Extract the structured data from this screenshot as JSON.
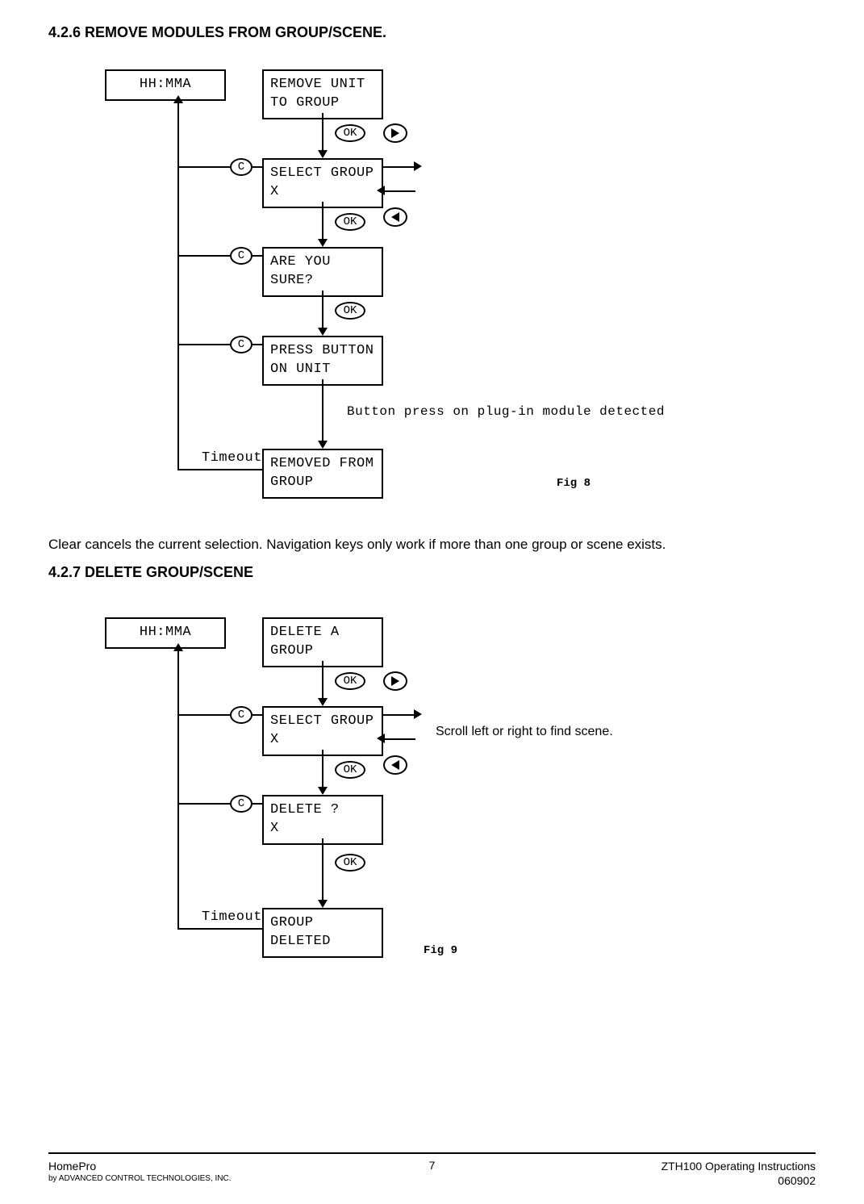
{
  "sections": {
    "s1_title": "4.2.6 REMOVE MODULES FROM GROUP/SCENE.",
    "s1_body": "Clear cancels the current selection.  Navigation keys only work if more than one group or scene exists.",
    "s2_title": "4.2.7  DELETE  GROUP/SCENE"
  },
  "diagram1": {
    "box_time": "HH:MMA",
    "box_remove": "REMOVE UNIT\nTO GROUP",
    "box_select": "SELECT GROUP\nX",
    "box_sure": "ARE YOU\nSURE?",
    "box_press": "PRESS BUTTON\nON UNIT",
    "box_done": "REMOVED FROM\nGROUP",
    "ok": "OK",
    "c": "C",
    "timeout": "Timeout",
    "detected": "Button press on plug-in module detected",
    "fig": "Fig 8"
  },
  "diagram2": {
    "box_time": "HH:MMA",
    "box_delete": "DELETE A\nGROUP",
    "box_select": "SELECT GROUP\nX",
    "box_confirm": "DELETE ?\nX",
    "box_done": "GROUP\nDELETED",
    "ok": "OK",
    "c": "C",
    "timeout": "Timeout",
    "scroll_note": "Scroll left or right to find scene.",
    "fig": "Fig 9"
  },
  "footer": {
    "brand": "HomePro",
    "sub": "by ADVANCED CONTROL TECHNOLOGIES, INC.",
    "page": "7",
    "doc": "ZTH100 Operating Instructions",
    "date": "060902"
  }
}
